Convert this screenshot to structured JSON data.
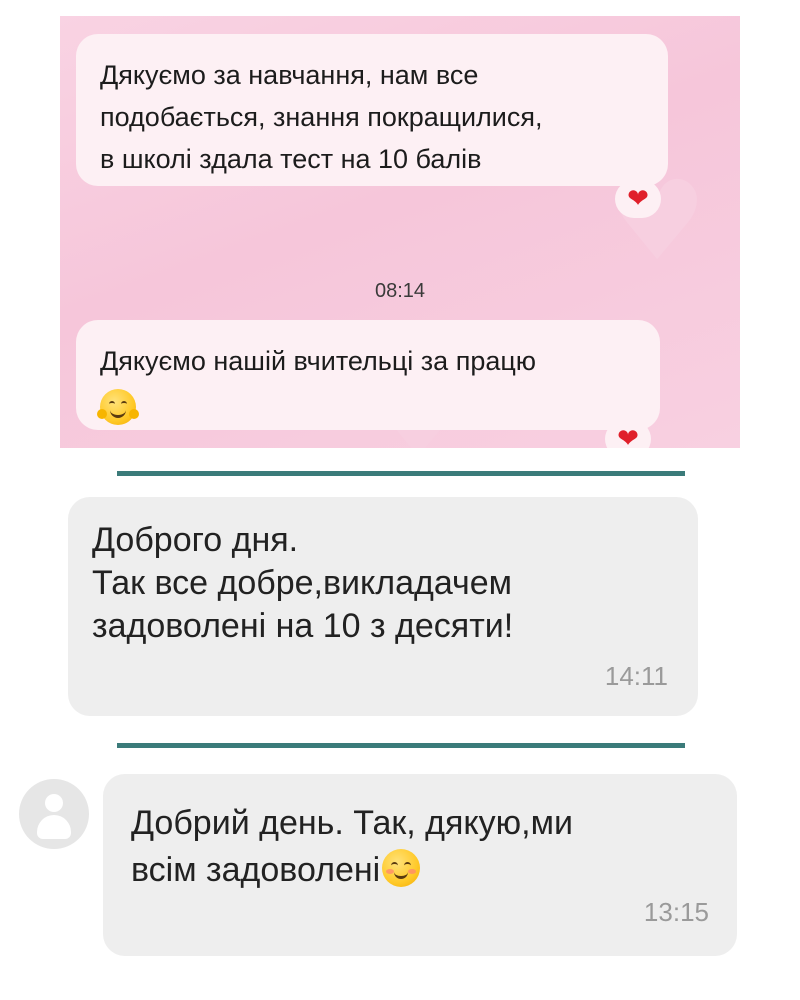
{
  "chat1": {
    "message1": {
      "lines": [
        "Дякуємо за навчання, нам все",
        "подобається, знання покращилися,",
        "в школі здала тест на 10 балів"
      ],
      "reaction": "❤"
    },
    "time": "08:14",
    "message2": {
      "text": "Дякуємо нашій вчительці за працю",
      "emoji": "hugging-face-emoji",
      "reaction": "❤"
    }
  },
  "chat2": {
    "message": {
      "lines": [
        "Доброго дня.",
        "Так все добре,викладачем",
        "задоволені на 10 з десяти!"
      ],
      "time": "14:11"
    }
  },
  "chat3": {
    "message": {
      "lines": [
        "Добрий день. Так, дякую,ми",
        "всім задоволені"
      ],
      "emoji": "smiling-face-emoji",
      "time": "13:15"
    }
  },
  "colors": {
    "pink_background": "#f7c9dc",
    "pink_bubble": "#fdf0f4",
    "grey_bubble": "#eeeeee",
    "divider": "#3b7b7a",
    "heart": "#e0202b"
  }
}
